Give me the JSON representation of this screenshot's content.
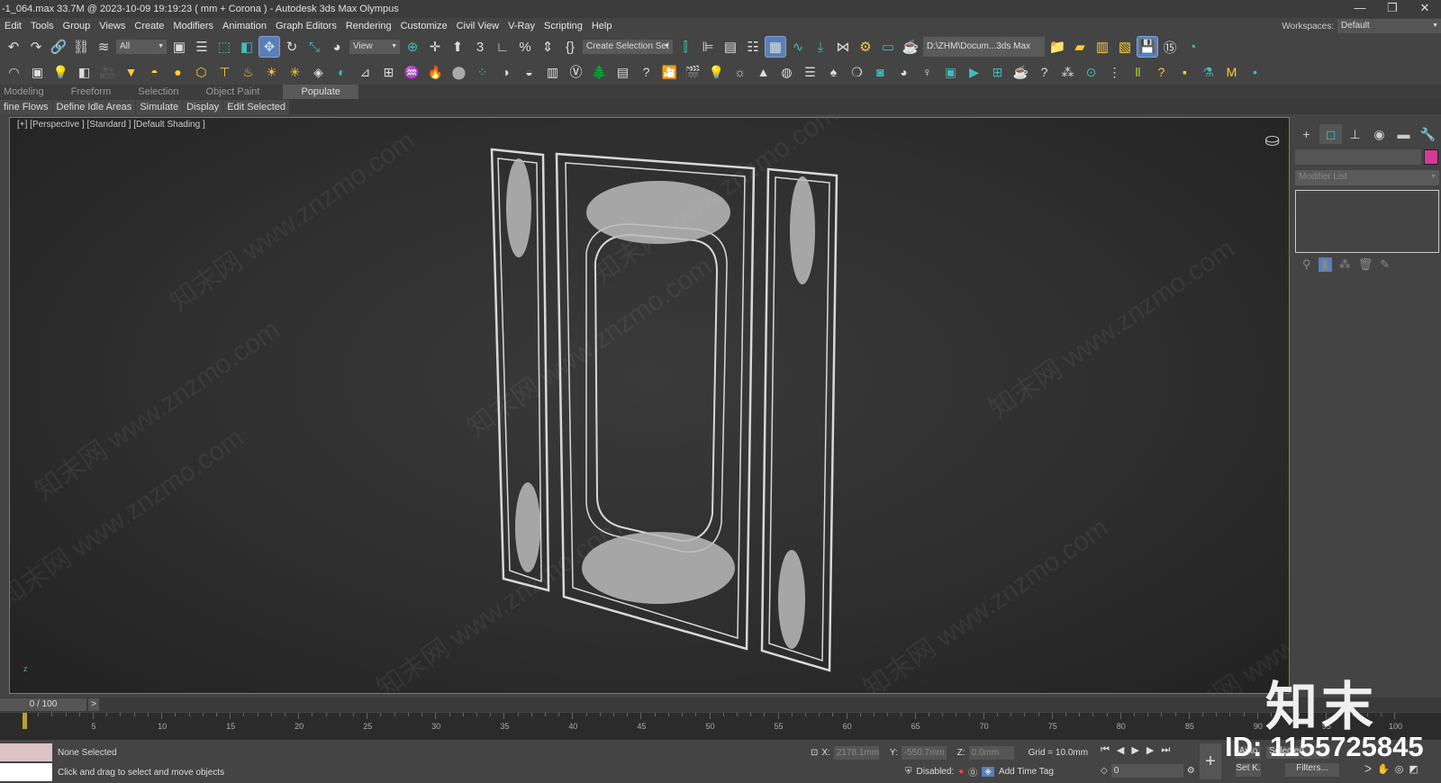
{
  "window": {
    "title": "-1_064.max  33.7M @ 2023-10-09 19:19:23  ( mm + Corona ) - Autodesk 3ds Max Olympus",
    "min": "—",
    "restore": "❐",
    "close": "✕"
  },
  "menu": [
    "Edit",
    "Tools",
    "Group",
    "Views",
    "Create",
    "Modifiers",
    "Animation",
    "Graph Editors",
    "Rendering",
    "Customize",
    "Civil View",
    "V-Ray",
    "Scripting",
    "Help"
  ],
  "workspaces": {
    "label": "Workspaces:",
    "value": "Default"
  },
  "toolbar1": {
    "filter": "All",
    "ref_coord": "View",
    "selection_set": "Create Selection Set",
    "project_path": "D:\\ZHM\\Docum...3ds Max 202·",
    "icons_a": [
      [
        "undo-icon",
        "↶",
        "#ddd"
      ],
      [
        "redo-icon",
        "↷",
        "#ddd"
      ],
      [
        "link-icon",
        "🔗",
        "#ddd"
      ],
      [
        "unlink-icon",
        "⛓",
        "#ddd"
      ],
      [
        "bind-space-warp-icon",
        "≋",
        "#ddd"
      ]
    ],
    "icons_b": [
      [
        "select-object-icon",
        "▣",
        "#ddd"
      ],
      [
        "select-by-name-icon",
        "☰",
        "#ddd"
      ],
      [
        "rect-region-icon",
        "⬚",
        "#4bb"
      ],
      [
        "window-crossing-icon",
        "◧",
        "#4bb"
      ],
      [
        "move-icon",
        "✥",
        "#bde"
      ],
      [
        "rotate-icon",
        "↻",
        "#ddd"
      ],
      [
        "scale-icon",
        "⤡",
        "#4bb"
      ],
      [
        "placement-icon",
        "◕",
        "#ddd"
      ]
    ],
    "icons_c": [
      [
        "pivot-icon",
        "⊕",
        "#4bb"
      ],
      [
        "manipulate-icon",
        "✛",
        "#ddd"
      ],
      [
        "keyboard-shortcut-icon",
        "⬆",
        "#ddd"
      ],
      [
        "snap-3d-icon",
        "3",
        "#ddd"
      ],
      [
        "angle-snap-icon",
        "∟",
        "#ddd"
      ],
      [
        "percent-snap-icon",
        "%",
        "#ddd"
      ],
      [
        "spinner-snap-icon",
        "⇕",
        "#ddd"
      ],
      [
        "edit-named-sets-icon",
        "{}",
        "#ddd"
      ]
    ],
    "icons_d": [
      [
        "mirror-icon",
        "⫿",
        "#4bb"
      ],
      [
        "align-icon",
        "⊫",
        "#ddd"
      ],
      [
        "scene-explorer-icon",
        "▤",
        "#ddd"
      ],
      [
        "layer-explorer-icon",
        "☷",
        "#ddd"
      ],
      [
        "toggle-ribbon-icon",
        "▦",
        "#ddd"
      ],
      [
        "curve-editor-icon",
        "∿",
        "#4bb"
      ],
      [
        "dope-sheet-icon",
        "⤓",
        "#4bb"
      ],
      [
        "schematic-view-icon",
        "⋈",
        "#ddd"
      ],
      [
        "render-setup-icon",
        "⚙",
        "#fc3"
      ],
      [
        "rendered-frame-icon",
        "▭",
        "#4bb"
      ],
      [
        "render-icon",
        "☕",
        "#ddd"
      ]
    ],
    "icons_e": [
      [
        "asset-tracking-icon",
        "📁",
        "#fc3"
      ],
      [
        "open-folder-icon",
        "▰",
        "#fc3"
      ],
      [
        "project-icon",
        "▥",
        "#fc3"
      ],
      [
        "set-project-icon",
        "▧",
        "#fc3"
      ],
      [
        "autobackup-icon",
        "💾",
        "#4bb"
      ],
      [
        "timer-15-icon",
        "⑮",
        "#ddd"
      ],
      [
        "history-icon",
        "◔",
        "#4bb"
      ]
    ]
  },
  "toolbar2": {
    "icons": [
      [
        "shape-icon",
        "◠",
        "#ddd"
      ],
      [
        "box-icon",
        "▣",
        "#ddd"
      ],
      [
        "light-bulb-icon",
        "💡",
        "#fc3"
      ],
      [
        "ies-light-icon",
        "◧",
        "#ddd"
      ],
      [
        "camera-icon",
        "🎥",
        "#ddd"
      ],
      [
        "vray-light-icon",
        "▼",
        "#fc3"
      ],
      [
        "dome-light-icon",
        "◓",
        "#fc3"
      ],
      [
        "sphere-light-icon",
        "●",
        "#fc3"
      ],
      [
        "mesh-light-icon",
        "⬡",
        "#fc3"
      ],
      [
        "spot-light-icon",
        "⊤",
        "#fc3"
      ],
      [
        "ambient-light-icon",
        "♨",
        "#fc3"
      ],
      [
        "sun-icon",
        "☀",
        "#fc3"
      ],
      [
        "sky-icon",
        "✳",
        "#fc3"
      ],
      [
        "proxy-icon",
        "◈",
        "#ddd"
      ],
      [
        "fur-icon",
        "◐",
        "#4bb"
      ],
      [
        "plane-icon",
        "⊿",
        "#ddd"
      ],
      [
        "infinite-plane-icon",
        "⊞",
        "#ddd"
      ],
      [
        "grass-icon",
        "♒",
        "#ddd"
      ],
      [
        "fire-icon",
        "🔥",
        "#4bb"
      ],
      [
        "material-sphere-icon",
        "⬤",
        "#aaa"
      ],
      [
        "material-editor-icon",
        "⁘",
        "#4bb"
      ],
      [
        "palette-icon",
        "◑",
        "#ddd"
      ],
      [
        "mat-lib-icon",
        "◒",
        "#ddd"
      ],
      [
        "vfb-icon",
        "▥",
        "#ddd"
      ],
      [
        "vray-logo-icon",
        "Ⓥ",
        "#fff"
      ],
      [
        "forest-icon",
        "🌲",
        "#ddd"
      ],
      [
        "script-icon",
        "▤",
        "#ddd"
      ],
      [
        "help-icon",
        "?",
        "#ddd"
      ],
      [
        "camera-cine-icon",
        "🎦",
        "#4bb"
      ],
      [
        "camera-add-icon",
        "🎬",
        "#ddd"
      ],
      [
        "bulb-icon",
        "💡",
        "#4bb"
      ],
      [
        "sun-light-icon",
        "☼",
        "#ddd"
      ],
      [
        "tree-icon",
        "▲",
        "#ddd"
      ],
      [
        "scatter-icon",
        "◍",
        "#ddd"
      ],
      [
        "list-icon",
        "☰",
        "#ddd"
      ],
      [
        "tree-doc-icon",
        "♠",
        "#ddd"
      ],
      [
        "ring-icon",
        "❍",
        "#ddd"
      ],
      [
        "screen-icon",
        "◙",
        "#4bb"
      ],
      [
        "color-icon",
        "◕",
        "#ddd"
      ],
      [
        "lamp-icon",
        "♀",
        "#ddd"
      ],
      [
        "frame-icon",
        "▣",
        "#4bb"
      ],
      [
        "play-frame-icon",
        "▶",
        "#4bb"
      ],
      [
        "grid-icon",
        "⊞",
        "#4bb"
      ],
      [
        "teapot-icon",
        "☕",
        "#ddd"
      ],
      [
        "help2-icon",
        "?",
        "#ddd"
      ],
      [
        "transform-icon",
        "⁂",
        "#ddd"
      ],
      [
        "target-icon",
        "⊙",
        "#4bb"
      ],
      [
        "axis-icon",
        "⋮",
        "#ddd"
      ],
      [
        "m1-icon",
        "Ⅱ",
        "#9c3"
      ],
      [
        "m2-icon",
        "?",
        "#fc3"
      ],
      [
        "m3-icon",
        "▪",
        "#fc3"
      ],
      [
        "m4-icon",
        "⚗",
        "#4bb"
      ],
      [
        "m5-icon",
        "M",
        "#fc3"
      ],
      [
        "m6-icon",
        "•",
        "#4bb"
      ]
    ]
  },
  "ribbon": {
    "tabs": [
      "Modeling",
      "Freeform",
      "Selection",
      "Object Paint",
      "Populate"
    ],
    "active": "Populate",
    "sub": [
      "fine Flows",
      "Define Idle Areas",
      "Simulate",
      "Display",
      "Edit Selected"
    ]
  },
  "viewport": {
    "label": "[+] [Perspective ] [Standard ] [Default Shading ]",
    "watermark": "知末网 www.znzmo.com"
  },
  "command_panel": {
    "tabs": [
      [
        "create-icon",
        "+"
      ],
      [
        "modify-icon",
        "◻"
      ],
      [
        "hierarchy-icon",
        "⊥"
      ],
      [
        "motion-icon",
        "◉"
      ],
      [
        "display-icon",
        "▬"
      ],
      [
        "utilities-icon",
        "🔧"
      ]
    ],
    "object_name": "",
    "object_color": "#d63a96",
    "modifier_list": "Modifier List",
    "stack_icons": [
      [
        "pin-stack-icon",
        "⚲"
      ],
      [
        "show-end-result-icon",
        "▮"
      ],
      [
        "make-unique-icon",
        "⁂"
      ],
      [
        "remove-modifier-icon",
        "🗑"
      ],
      [
        "configure-sets-icon",
        "✎"
      ]
    ]
  },
  "timeline": {
    "frame": "0 / 100",
    "next": ">",
    "start": 0,
    "end": 100,
    "step": 5,
    "current": 0
  },
  "status": {
    "selection": "None Selected",
    "prompt": "Click and drag to select and move objects",
    "x_label": "X:",
    "x": "2178.1mm",
    "y_label": "Y:",
    "y": "-550.7mm",
    "z_label": "Z:",
    "z": "0.0mm",
    "grid": "Grid = 10.0mm",
    "disabled": "Disabled:",
    "add_time_tag": "Add Time Tag",
    "frame_spinner": "0",
    "auto_key": "Auto",
    "selected": "Selected",
    "set_key": "Set K.",
    "filters": "Filters..."
  },
  "watermark": {
    "logo": "知末",
    "id": "ID: 1155725845"
  }
}
